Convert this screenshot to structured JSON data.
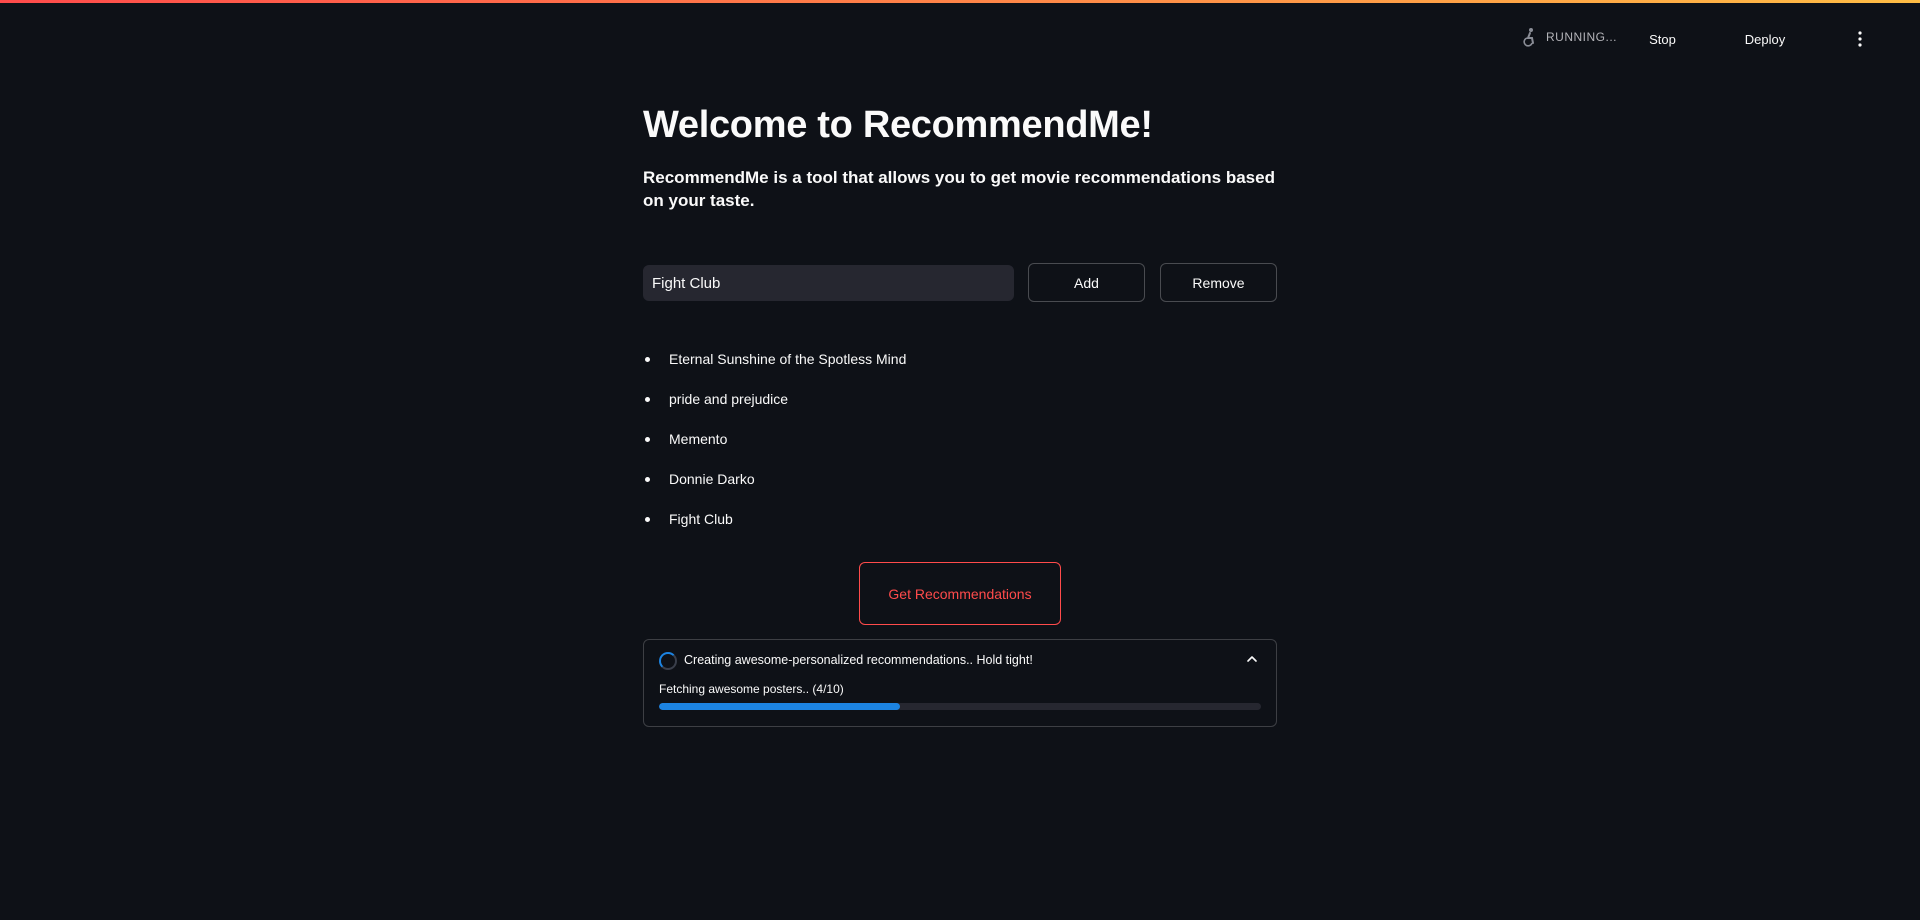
{
  "header": {
    "status_text": "RUNNING...",
    "stop_label": "Stop",
    "deploy_label": "Deploy",
    "status_icon": "running-figure-icon",
    "menu_icon": "kebab-menu-icon"
  },
  "main": {
    "title": "Welcome to RecommendMe!",
    "subtitle": "RecommendMe is a tool that allows you to get movie recommendations based on your taste.",
    "movie_input": {
      "value": "Fight Club",
      "placeholder": ""
    },
    "add_label": "Add",
    "remove_label": "Remove",
    "movies": [
      "Eternal Sunshine of the Spotless Mind",
      "pride and prejudice",
      "Memento",
      "Donnie Darko",
      "Fight Club"
    ],
    "get_recommendations_label": "Get Recommendations",
    "status_box": {
      "label": "Creating awesome-personalized recommendations.. Hold tight!",
      "progress_text": "Fetching awesome posters.. (4/10)",
      "progress_fraction": 0.4
    }
  },
  "colors": {
    "background": "#0e1117",
    "accent": "#ff4b4b",
    "progress": "#1c83e1",
    "input_bg": "#262730"
  }
}
